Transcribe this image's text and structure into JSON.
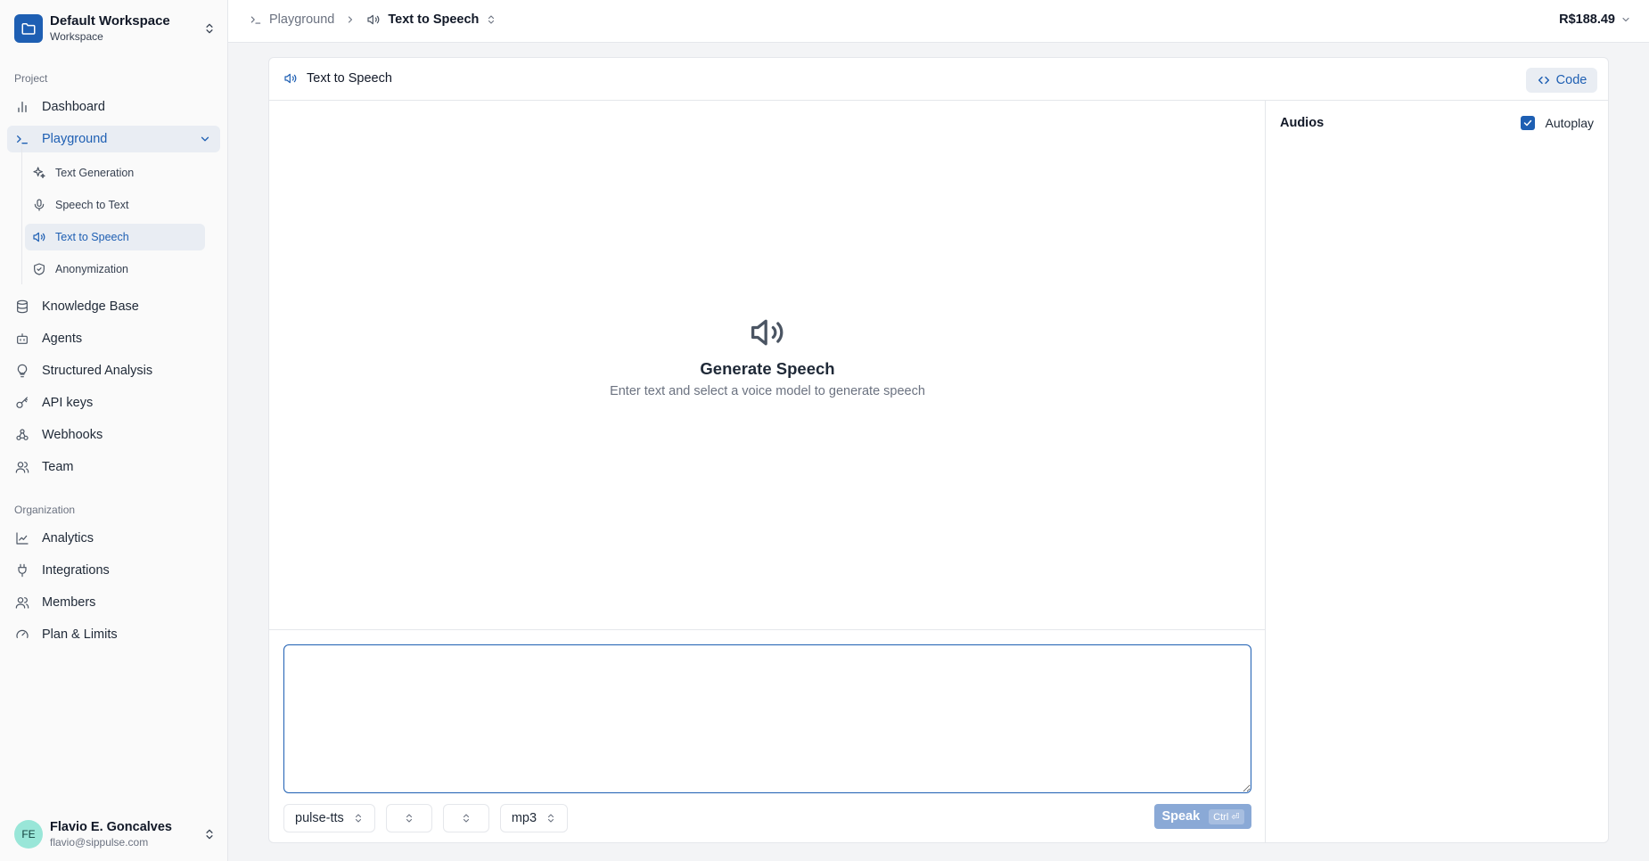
{
  "workspace": {
    "name": "Default Workspace",
    "subtitle": "Workspace"
  },
  "sidebar": {
    "project_label": "Project",
    "dashboard": "Dashboard",
    "playground": "Playground",
    "playground_items": [
      {
        "label": "Text Generation",
        "icon": "sparkles-icon"
      },
      {
        "label": "Speech to Text",
        "icon": "microphone-icon"
      },
      {
        "label": "Text to Speech",
        "icon": "speaker-icon"
      },
      {
        "label": "Anonymization",
        "icon": "shield-check-icon"
      }
    ],
    "project_items": [
      {
        "label": "Knowledge Base",
        "icon": "database-icon"
      },
      {
        "label": "Agents",
        "icon": "bot-icon"
      },
      {
        "label": "Structured Analysis",
        "icon": "lightbulb-icon"
      },
      {
        "label": "API keys",
        "icon": "key-icon"
      },
      {
        "label": "Webhooks",
        "icon": "webhook-icon"
      },
      {
        "label": "Team",
        "icon": "users-icon"
      }
    ],
    "organization_label": "Organization",
    "organization_items": [
      {
        "label": "Analytics",
        "icon": "chart-line-icon"
      },
      {
        "label": "Integrations",
        "icon": "plug-icon"
      },
      {
        "label": "Members",
        "icon": "users-icon"
      },
      {
        "label": "Plan & Limits",
        "icon": "gauge-icon"
      }
    ]
  },
  "user": {
    "initials": "FE",
    "name": "Flavio E. Goncalves",
    "email": "flavio@sippulse.com"
  },
  "header": {
    "breadcrumb_parent": "Playground",
    "breadcrumb_current": "Text to Speech",
    "balance": "R$188.49"
  },
  "panel": {
    "title": "Text to Speech",
    "code_button": "Code",
    "empty_title": "Generate Speech",
    "empty_subtitle": "Enter text and select a voice model to generate speech",
    "textarea_value": "",
    "model_select": "pulse-tts",
    "voice_select": "",
    "language_select": "",
    "format_select": "mp3",
    "speak_button": "Speak",
    "speak_shortcut": "Ctrl ⏎",
    "audios_title": "Audios",
    "autoplay_label": "Autoplay",
    "autoplay_checked": true
  },
  "colors": {
    "accent": "#1e5fb3",
    "active_bg": "#e9edf3",
    "speak_disabled": "#8aa9d6"
  }
}
